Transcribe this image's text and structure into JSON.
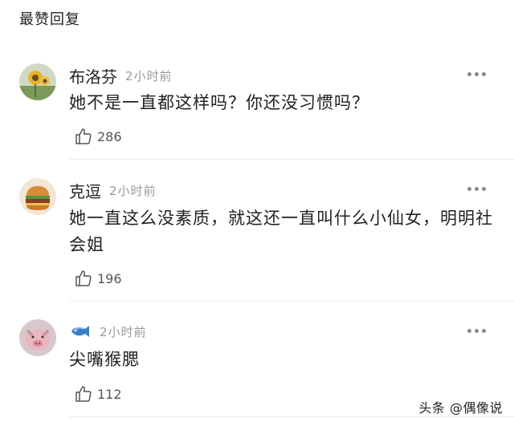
{
  "section_title": "最赞回复",
  "comments": [
    {
      "username": "布洛芬",
      "time": "2小时前",
      "text": "她不是一直都这样吗？你还没习惯吗？",
      "likes": "286",
      "avatar_icon": "sunflower-avatar"
    },
    {
      "username": "克逗",
      "time": "2小时前",
      "text": "她一直这么没素质，就这还一直叫什么小仙女，明明社会姐",
      "likes": "196",
      "avatar_icon": "burger-avatar"
    },
    {
      "username": "",
      "username_icon": "fish-emoji",
      "time": "2小时前",
      "text": "尖嘴猴腮",
      "likes": "112",
      "avatar_icon": "pig-avatar"
    }
  ],
  "watermark": "头条 @偶像说",
  "colors": {
    "text": "#222222",
    "muted": "#999999",
    "divider": "#ececec"
  }
}
